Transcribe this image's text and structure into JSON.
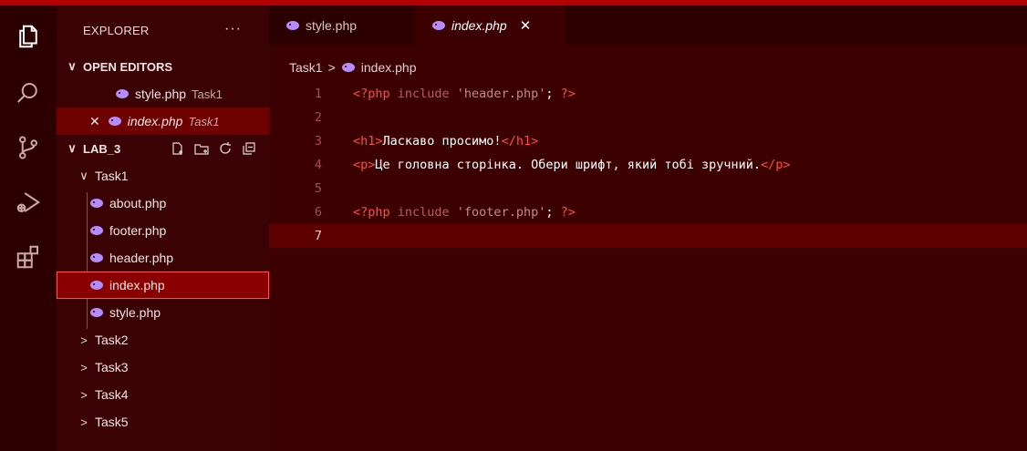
{
  "explorer": {
    "title": "EXPLORER",
    "more": "···",
    "open_editors_label": "OPEN EDITORS",
    "open_editors": [
      {
        "name": "style.php",
        "folder": "Task1"
      },
      {
        "name": "index.php",
        "folder": "Task1"
      }
    ],
    "project_label": "LAB_3",
    "tree": {
      "folder": "Task1",
      "files": [
        "about.php",
        "footer.php",
        "header.php",
        "index.php",
        "style.php"
      ],
      "collapsed_folders": [
        "Task2",
        "Task3",
        "Task4",
        "Task5"
      ]
    }
  },
  "tabs": [
    {
      "label": "style.php",
      "active": false
    },
    {
      "label": "index.php",
      "active": true
    }
  ],
  "close_symbol": "✕",
  "breadcrumb": {
    "folder": "Task1",
    "separator": ">",
    "file": "index.php"
  },
  "line_numbers": [
    "1",
    "2",
    "3",
    "4",
    "5",
    "6",
    "7"
  ],
  "code": {
    "l1_open": "<?php",
    "l1_kw": " include ",
    "l1_str": "'header.php'",
    "l1_semi": "; ",
    "l1_close": "?>",
    "l3_open": "<h1>",
    "l3_text": "Ласкаво просимо!",
    "l3_close": "</h1>",
    "l4_open": "<p>",
    "l4_text": "Це головна сторінка. Обери шрифт, який тобі зручний.",
    "l4_close": "</p>",
    "l6_open": "<?php",
    "l6_kw": " include ",
    "l6_str": "'footer.php'",
    "l6_semi": "; ",
    "l6_close": "?>"
  },
  "colors": {
    "background": "#3c0000",
    "activity_bar": "#2d0000",
    "accent": "#ff4a4a",
    "selected": "#8a0000",
    "php_icon": "#b48cff"
  }
}
